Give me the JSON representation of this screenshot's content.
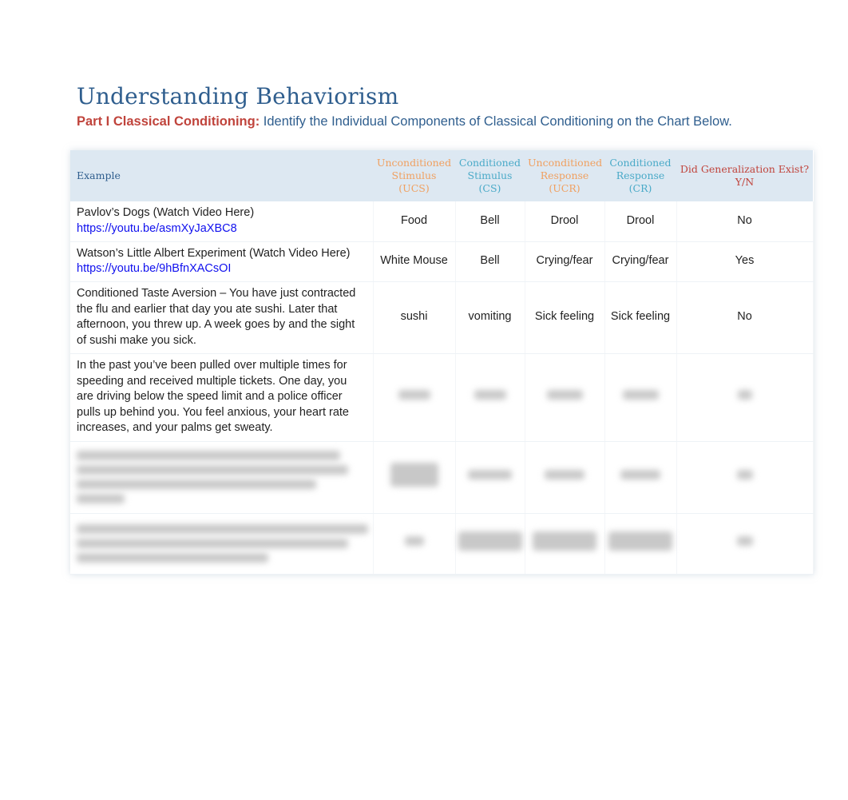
{
  "title": "Understanding Behaviorism",
  "subtitle": {
    "bold": "Part I Classical Conditioning:",
    "text": " Identify the Individual Components of Classical Conditioning on the Chart Below."
  },
  "colors": {
    "title": "#2f5e8e",
    "bold": "#c0443c",
    "ucs": "#f0a060",
    "cs": "#4aaac8",
    "gen": "#c0443c",
    "link": "#1010ee"
  },
  "headers": [
    "Example",
    "Unconditioned Stimulus (UCS)",
    "Conditioned Stimulus (CS)",
    "Unconditioned Response (UCR)",
    "Conditioned Response (CR)",
    "Did Generalization Exist? Y/N"
  ],
  "rows": [
    {
      "example": "Pavlov’s Dogs (Watch Video Here)",
      "link": "https://youtu.be/asmXyJaXBC8",
      "cells": [
        "Food",
        "Bell",
        "Drool",
        "Drool",
        "No"
      ]
    },
    {
      "example": "Watson’s Little Albert Experiment (Watch Video Here)",
      "link": "https://youtu.be/9hBfnXACsOI",
      "cells": [
        "White Mouse",
        "Bell",
        "Crying/fear",
        "Crying/fear",
        "Yes"
      ]
    },
    {
      "example": "Conditioned Taste Aversion – You have just contracted the flu and earlier that day you ate sushi. Later that afternoon, you threw up. A week goes by and the sight of sushi make you sick.",
      "cells": [
        "sushi",
        "vomiting",
        "Sick feeling",
        "Sick feeling",
        "No"
      ]
    },
    {
      "example": "In the past you’ve been pulled over multiple times for speeding and received multiple tickets. One day, you are driving below the speed limit and a police officer pulls up behind you. You feel anxious, your heart rate increases, and your palms get sweaty."
    }
  ]
}
